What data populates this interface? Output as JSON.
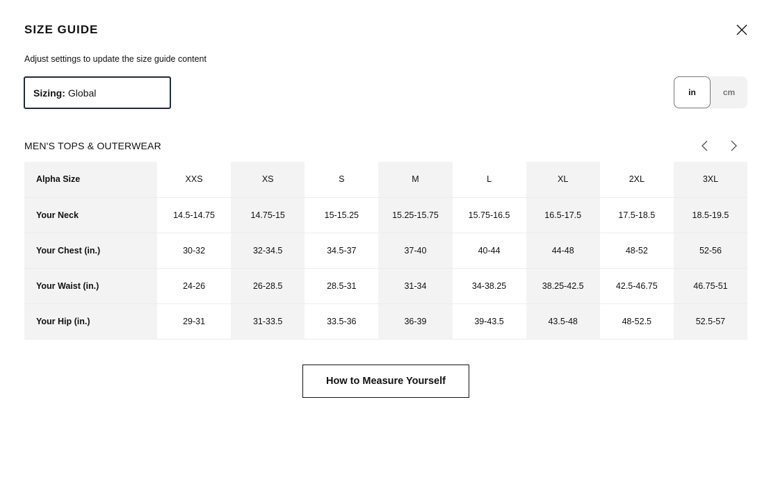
{
  "modal": {
    "title": "SIZE GUIDE",
    "subtitle": "Adjust settings to update the size guide content"
  },
  "sizing": {
    "label": "Sizing:",
    "value": "Global"
  },
  "units": {
    "options": [
      "in",
      "cm"
    ],
    "selected": "in"
  },
  "section": {
    "title": "MEN'S TOPS & OUTERWEAR"
  },
  "table": {
    "rows": [
      {
        "label": "Alpha Size",
        "cells": [
          "XXS",
          "XS",
          "S",
          "M",
          "L",
          "XL",
          "2XL",
          "3XL"
        ]
      },
      {
        "label": "Your Neck",
        "cells": [
          "14.5-14.75",
          "14.75-15",
          "15-15.25",
          "15.25-15.75",
          "15.75-16.5",
          "16.5-17.5",
          "17.5-18.5",
          "18.5-19.5"
        ]
      },
      {
        "label": "Your Chest (in.)",
        "cells": [
          "30-32",
          "32-34.5",
          "34.5-37",
          "37-40",
          "40-44",
          "44-48",
          "48-52",
          "52-56"
        ]
      },
      {
        "label": "Your Waist (in.)",
        "cells": [
          "24-26",
          "26-28.5",
          "28.5-31",
          "31-34",
          "34-38.25",
          "38.25-42.5",
          "42.5-46.75",
          "46.75-51"
        ]
      },
      {
        "label": "Your Hip (in.)",
        "cells": [
          "29-31",
          "31-33.5",
          "33.5-36",
          "36-39",
          "39-43.5",
          "43.5-48",
          "48-52.5",
          "52.5-57"
        ]
      }
    ]
  },
  "measure_button": {
    "label": "How to Measure Yourself"
  },
  "icons": {
    "close": "close-icon",
    "prev": "chevron-left-icon",
    "next": "chevron-right-icon"
  }
}
